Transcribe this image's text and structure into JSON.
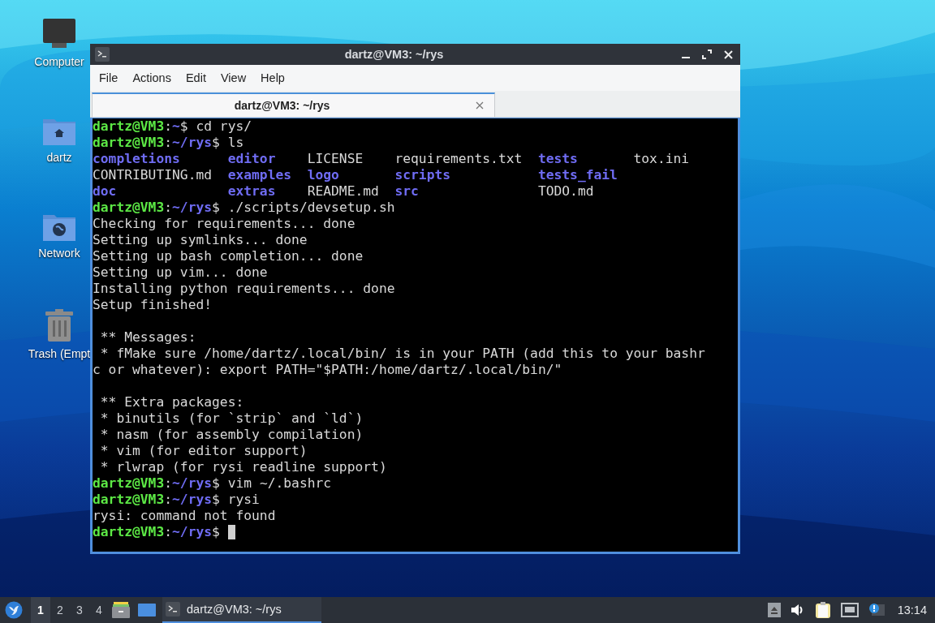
{
  "desktop_icons": [
    {
      "label": "Computer",
      "kind": "computer"
    },
    {
      "label": "dartz",
      "kind": "home"
    },
    {
      "label": "Network",
      "kind": "network"
    },
    {
      "label": "Trash (Empt",
      "kind": "trash"
    }
  ],
  "window": {
    "title": "dartz@VM3: ~/rys",
    "menu": [
      "File",
      "Actions",
      "Edit",
      "View",
      "Help"
    ],
    "tabs": [
      {
        "label": "dartz@VM3: ~/rys",
        "selected": true
      }
    ],
    "terminal": [
      {
        "kind": "line",
        "segments": [
          {
            "kind": "user",
            "text": "dartz@VM3"
          },
          {
            "kind": "plain",
            "text": ":"
          },
          {
            "kind": "path",
            "text": "~"
          },
          {
            "kind": "plain",
            "text": "$ cd rys/"
          }
        ]
      },
      {
        "kind": "line",
        "segments": [
          {
            "kind": "user",
            "text": "dartz@VM3"
          },
          {
            "kind": "plain",
            "text": ":"
          },
          {
            "kind": "path",
            "text": "~/rys"
          },
          {
            "kind": "plain",
            "text": "$ ls"
          }
        ]
      },
      {
        "kind": "listing",
        "cells": [
          {
            "kind": "dir",
            "text": "completions"
          },
          {
            "kind": "dir",
            "text": "editor"
          },
          {
            "kind": "file",
            "text": "LICENSE"
          },
          {
            "kind": "file",
            "text": "requirements.txt"
          },
          {
            "kind": "dir",
            "text": "tests"
          },
          {
            "kind": "file",
            "text": "tox.ini"
          }
        ]
      },
      {
        "kind": "listing",
        "cells": [
          {
            "kind": "file",
            "text": "CONTRIBUTING.md"
          },
          {
            "kind": "dir",
            "text": "examples"
          },
          {
            "kind": "dir",
            "text": "logo"
          },
          {
            "kind": "dir",
            "text": "scripts"
          },
          {
            "kind": "dir",
            "text": "tests_fail"
          }
        ]
      },
      {
        "kind": "listing",
        "cells": [
          {
            "kind": "dir",
            "text": "doc"
          },
          {
            "kind": "dir",
            "text": "extras"
          },
          {
            "kind": "file",
            "text": "README.md"
          },
          {
            "kind": "dir",
            "text": "src"
          },
          {
            "kind": "file",
            "text": "TODO.md"
          }
        ]
      },
      {
        "kind": "line",
        "segments": [
          {
            "kind": "user",
            "text": "dartz@VM3"
          },
          {
            "kind": "plain",
            "text": ":"
          },
          {
            "kind": "path",
            "text": "~/rys"
          },
          {
            "kind": "plain",
            "text": "$ ./scripts/devsetup.sh"
          }
        ]
      },
      {
        "kind": "line",
        "segments": [
          {
            "kind": "plain",
            "text": "Checking for requirements... done"
          }
        ]
      },
      {
        "kind": "line",
        "segments": [
          {
            "kind": "plain",
            "text": "Setting up symlinks... done"
          }
        ]
      },
      {
        "kind": "line",
        "segments": [
          {
            "kind": "plain",
            "text": "Setting up bash completion... done"
          }
        ]
      },
      {
        "kind": "line",
        "segments": [
          {
            "kind": "plain",
            "text": "Setting up vim... done"
          }
        ]
      },
      {
        "kind": "line",
        "segments": [
          {
            "kind": "plain",
            "text": "Installing python requirements... done"
          }
        ]
      },
      {
        "kind": "line",
        "segments": [
          {
            "kind": "plain",
            "text": "Setup finished!"
          }
        ]
      },
      {
        "kind": "blank"
      },
      {
        "kind": "line",
        "segments": [
          {
            "kind": "plain",
            "text": " ** Messages:"
          }
        ]
      },
      {
        "kind": "line",
        "segments": [
          {
            "kind": "plain",
            "text": " * fMake sure /home/dartz/.local/bin/ is in your PATH (add this to your bashr"
          }
        ]
      },
      {
        "kind": "line",
        "segments": [
          {
            "kind": "plain",
            "text": "c or whatever): export PATH=\"$PATH:/home/dartz/.local/bin/\""
          }
        ]
      },
      {
        "kind": "blank"
      },
      {
        "kind": "line",
        "segments": [
          {
            "kind": "plain",
            "text": " ** Extra packages:"
          }
        ]
      },
      {
        "kind": "line",
        "segments": [
          {
            "kind": "plain",
            "text": " * binutils (for `strip` and `ld`)"
          }
        ]
      },
      {
        "kind": "line",
        "segments": [
          {
            "kind": "plain",
            "text": " * nasm (for assembly compilation)"
          }
        ]
      },
      {
        "kind": "line",
        "segments": [
          {
            "kind": "plain",
            "text": " * vim (for editor support)"
          }
        ]
      },
      {
        "kind": "line",
        "segments": [
          {
            "kind": "plain",
            "text": " * rlwrap (for rysi readline support)"
          }
        ]
      },
      {
        "kind": "line",
        "segments": [
          {
            "kind": "user",
            "text": "dartz@VM3"
          },
          {
            "kind": "plain",
            "text": ":"
          },
          {
            "kind": "path",
            "text": "~/rys"
          },
          {
            "kind": "plain",
            "text": "$ vim ~/.bashrc"
          }
        ]
      },
      {
        "kind": "line",
        "segments": [
          {
            "kind": "user",
            "text": "dartz@VM3"
          },
          {
            "kind": "plain",
            "text": ":"
          },
          {
            "kind": "path",
            "text": "~/rys"
          },
          {
            "kind": "plain",
            "text": "$ rysi"
          }
        ]
      },
      {
        "kind": "line",
        "segments": [
          {
            "kind": "plain",
            "text": "rysi: command not found"
          }
        ]
      },
      {
        "kind": "prompt",
        "segments": [
          {
            "kind": "user",
            "text": "dartz@VM3"
          },
          {
            "kind": "plain",
            "text": ":"
          },
          {
            "kind": "path",
            "text": "~/rys"
          },
          {
            "kind": "plain",
            "text": "$ "
          }
        ]
      }
    ]
  },
  "taskbar": {
    "workspaces": [
      {
        "label": "1",
        "selected": true
      },
      {
        "label": "2",
        "selected": false
      },
      {
        "label": "3",
        "selected": false
      },
      {
        "label": "4",
        "selected": false
      }
    ],
    "tasks": [
      {
        "label": "dartz@VM3: ~/rys",
        "selected": true
      }
    ],
    "clock": "13:14"
  }
}
